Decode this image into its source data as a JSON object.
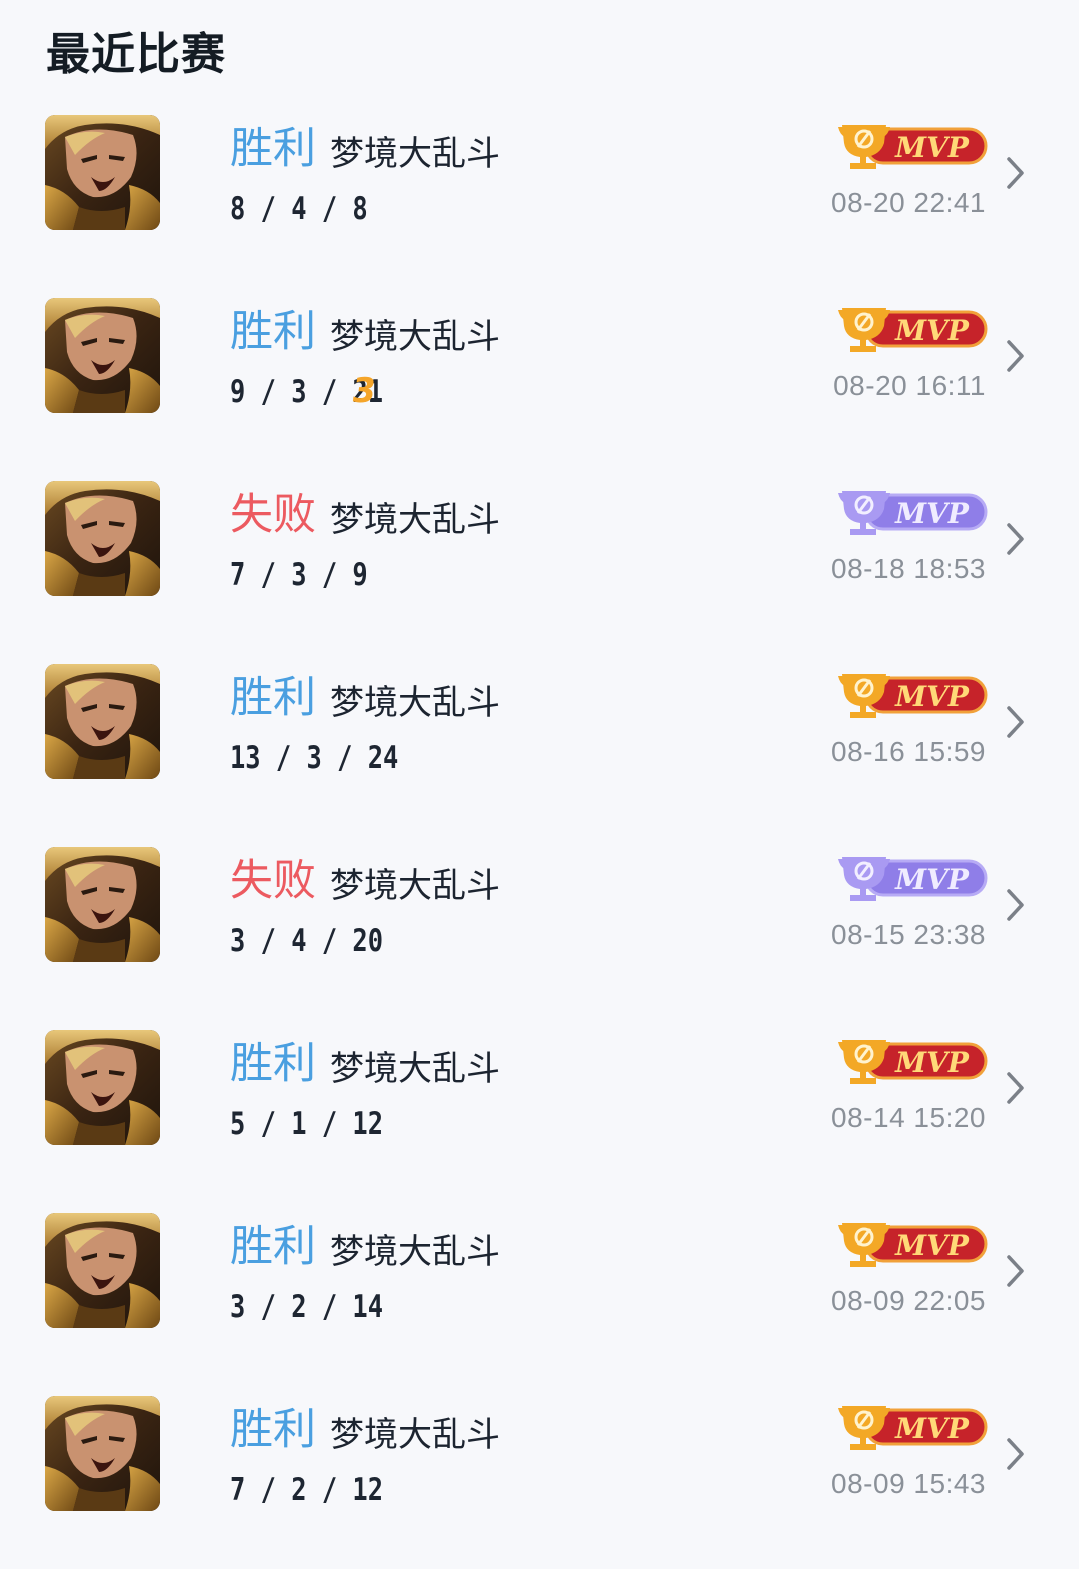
{
  "header": {
    "title": "最近比赛"
  },
  "colors": {
    "win": "#4a9fe0",
    "loss": "#ec5a60",
    "mvp_win": "#c6232a",
    "mvp_loss": "#8f7ee8",
    "triple_kill_badge": "#f5a52a"
  },
  "matches": [
    {
      "result": "胜利",
      "outcome": "win",
      "mode": "梦境大乱斗",
      "kda": "8 / 4 / 8",
      "badge": "",
      "mvp_label": "MVP",
      "mvp_style": "gold-red",
      "time": "08-20 22:41",
      "hero_icon": "hero-portrait"
    },
    {
      "result": "胜利",
      "outcome": "win",
      "mode": "梦境大乱斗",
      "kda": "9 / 3 / 21",
      "badge": "3",
      "mvp_label": "MVP",
      "mvp_style": "gold-red",
      "time": "08-20 16:11",
      "hero_icon": "hero-portrait"
    },
    {
      "result": "失败",
      "outcome": "loss",
      "mode": "梦境大乱斗",
      "kda": "7 / 3 / 9",
      "badge": "",
      "mvp_label": "MVP",
      "mvp_style": "purple",
      "time": "08-18 18:53",
      "hero_icon": "hero-portrait"
    },
    {
      "result": "胜利",
      "outcome": "win",
      "mode": "梦境大乱斗",
      "kda": "13 / 3 / 24",
      "badge": "",
      "mvp_label": "MVP",
      "mvp_style": "gold-red",
      "time": "08-16 15:59",
      "hero_icon": "hero-portrait"
    },
    {
      "result": "失败",
      "outcome": "loss",
      "mode": "梦境大乱斗",
      "kda": "3 / 4 / 20",
      "badge": "",
      "mvp_label": "MVP",
      "mvp_style": "purple",
      "time": "08-15 23:38",
      "hero_icon": "hero-portrait"
    },
    {
      "result": "胜利",
      "outcome": "win",
      "mode": "梦境大乱斗",
      "kda": "5 / 1 / 12",
      "badge": "",
      "mvp_label": "MVP",
      "mvp_style": "gold-red",
      "time": "08-14 15:20",
      "hero_icon": "hero-portrait"
    },
    {
      "result": "胜利",
      "outcome": "win",
      "mode": "梦境大乱斗",
      "kda": "3 / 2 / 14",
      "badge": "",
      "mvp_label": "MVP",
      "mvp_style": "gold-red",
      "time": "08-09 22:05",
      "hero_icon": "hero-portrait"
    },
    {
      "result": "胜利",
      "outcome": "win",
      "mode": "梦境大乱斗",
      "kda": "7 / 2 / 12",
      "badge": "",
      "mvp_label": "MVP",
      "mvp_style": "gold-red",
      "time": "08-09 15:43",
      "hero_icon": "hero-portrait"
    }
  ]
}
